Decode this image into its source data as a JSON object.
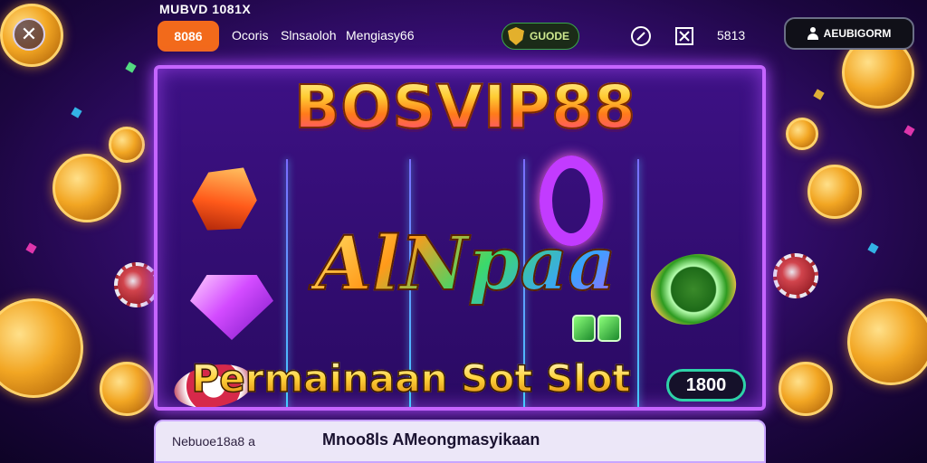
{
  "header": {
    "top_label": "MUBVD 1081X",
    "close_icon": "close-icon",
    "nav_pill_label": "8086",
    "nav_links": [
      "Ocoris",
      "Slnsaoloh",
      "Mengiasy66"
    ],
    "balance_label": "GUODE",
    "balance_icon": "shield-icon",
    "edit_icon": "pencil-icon",
    "x_icon": "x-box-icon",
    "counter": "5813",
    "account_label": "AEUBIGORM",
    "account_icon": "user-icon"
  },
  "game": {
    "logo_text": "BOSVIP88",
    "center_word": "AlNpaa",
    "banner_text": "Permainaan Sot Slot",
    "score_value": "1800",
    "colors": {
      "frame": "#c565ff",
      "accent_orange": "#f26a1b",
      "score_border": "#2ed2a8"
    }
  },
  "footer": {
    "left_text": "Nebuoe18a8 a",
    "main_text": "Mnoo8ls AMeongmasyikaan"
  }
}
